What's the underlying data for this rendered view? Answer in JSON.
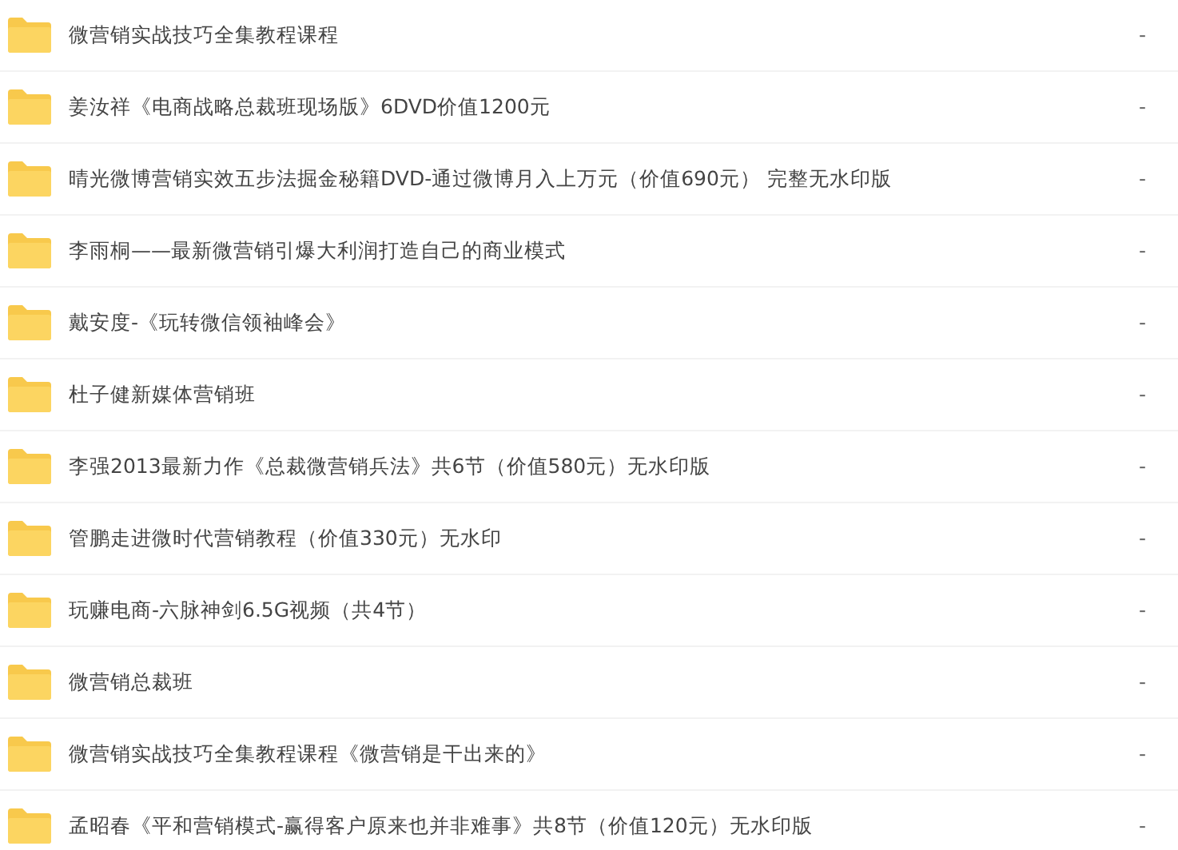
{
  "files": [
    {
      "name": "微营销实战技巧全集教程课程",
      "size": "-"
    },
    {
      "name": "姜汝祥《电商战略总裁班现场版》6DVD价值1200元",
      "size": "-"
    },
    {
      "name": "晴光微博营销实效五步法掘金秘籍DVD-通过微博月入上万元（价值690元） 完整无水印版",
      "size": "-"
    },
    {
      "name": "李雨桐——最新微营销引爆大利润打造自己的商业模式",
      "size": "-"
    },
    {
      "name": "戴安度-《玩转微信领袖峰会》",
      "size": "-"
    },
    {
      "name": "杜子健新媒体营销班",
      "size": "-"
    },
    {
      "name": "李强2013最新力作《总裁微营销兵法》共6节（价值580元）无水印版",
      "size": "-"
    },
    {
      "name": "管鹏走进微时代营销教程（价值330元）无水印",
      "size": "-"
    },
    {
      "name": "玩赚电商-六脉神剑6.5G视频（共4节）",
      "size": "-"
    },
    {
      "name": "微营销总裁班",
      "size": "-"
    },
    {
      "name": "微营销实战技巧全集教程课程《微营销是干出来的》",
      "size": "-"
    },
    {
      "name": "孟昭春《平和营销模式-赢得客户原来也并非难事》共8节（价值120元）无水印版",
      "size": "-"
    }
  ]
}
